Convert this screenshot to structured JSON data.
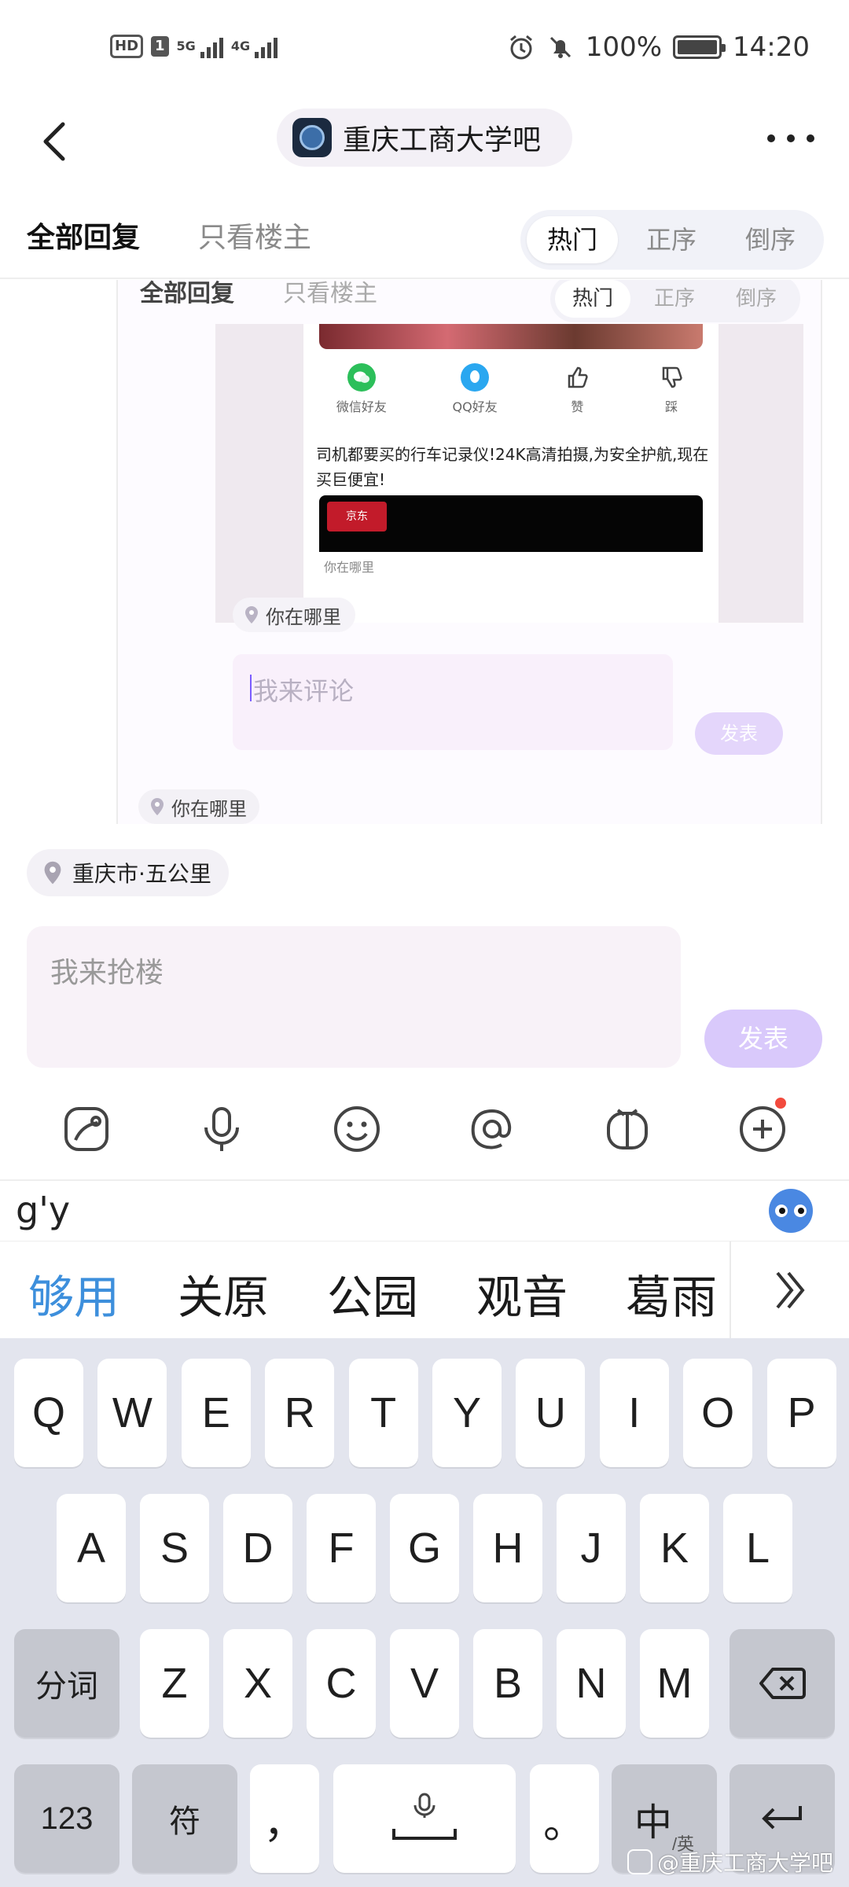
{
  "status_bar": {
    "hd": "HD",
    "sim": "1",
    "net1": "5G",
    "net2": "4G",
    "battery_pct": "100%",
    "battery_level": 1.0,
    "time": "14:20"
  },
  "header": {
    "forum_name": "重庆工商大学吧"
  },
  "tabs": {
    "all_replies": "全部回复",
    "op_only": "只看楼主",
    "sort": [
      "热门",
      "正序",
      "倒序"
    ],
    "active_sort": "热门"
  },
  "embedded": {
    "tabs": {
      "all_replies": "全部回复",
      "op_only": "只看楼主",
      "sort": [
        "热门",
        "正序",
        "倒序"
      ]
    },
    "share": [
      "微信好友",
      "QQ好友",
      "赞",
      "踩"
    ],
    "ad_text": "司机都要买的行车记录仪!24K高清拍摄,为安全护航,现在买巨便宜!",
    "ad_brand": "京东",
    "location_small": "你在哪里",
    "location": "你在哪里",
    "input_placeholder": "我来评论",
    "send": "发表",
    "location2": "你在哪里"
  },
  "compose": {
    "location": "重庆市·五公里",
    "placeholder": "我来抢楼",
    "send": "发表",
    "toolbar_icons": [
      "sticker-icon",
      "microphone-icon",
      "emoji-icon",
      "mention-icon",
      "gift-icon",
      "add-icon"
    ]
  },
  "ime": {
    "pinyin": "g'y",
    "candidates": [
      "够用",
      "关原",
      "公园",
      "观音",
      "葛雨"
    ],
    "rows": [
      [
        "Q",
        "W",
        "E",
        "R",
        "T",
        "Y",
        "U",
        "I",
        "O",
        "P"
      ],
      [
        "A",
        "S",
        "D",
        "F",
        "G",
        "H",
        "J",
        "K",
        "L"
      ],
      [
        "Z",
        "X",
        "C",
        "V",
        "B",
        "N",
        "M"
      ]
    ],
    "segment_key": "分词",
    "num_key": "123",
    "symbol_key": "符",
    "comma_key": "，",
    "period_key": "。",
    "lang_key_main": "中",
    "lang_key_sub": "/英"
  },
  "watermark": "@重庆工商大学吧",
  "colors": {
    "accent_purple": "#d9c9fb",
    "candidate_blue": "#3d8fdc",
    "keyboard_bg": "#e3e5ee"
  }
}
